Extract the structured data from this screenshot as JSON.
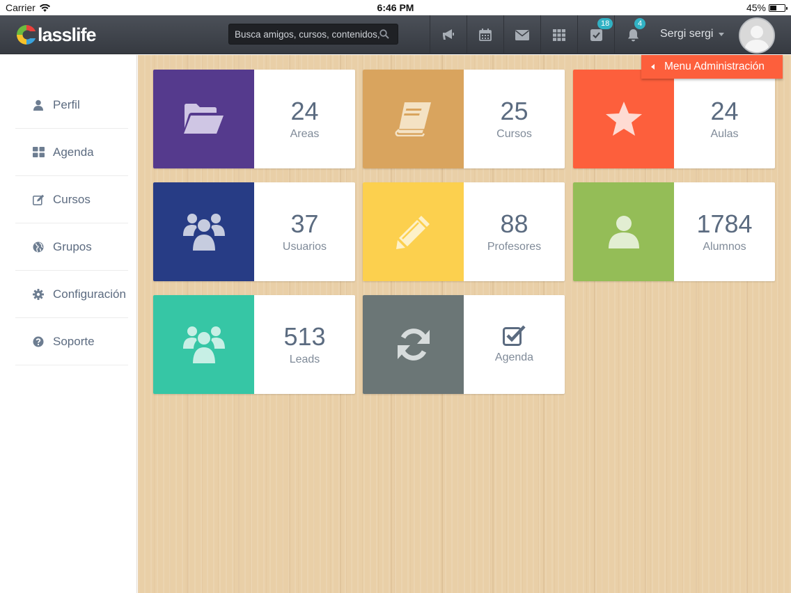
{
  "statusbar": {
    "carrier": "Carrier",
    "time": "6:46 PM",
    "battery": "45%",
    "battery_level": 0.45
  },
  "navbar": {
    "logo_text": "lasslife",
    "search_placeholder": "Busca amigos, cursos, contenidos, in",
    "icons": [
      "megaphone-icon",
      "calendar-icon",
      "envelope-icon",
      "grid-icon",
      "check-square-icon",
      "bell-icon"
    ],
    "tasks_badge": "18",
    "notifications_badge": "4",
    "user_name": "Sergi sergi"
  },
  "admin_menu": {
    "label": "Menu Administración"
  },
  "sidebar": {
    "items": [
      {
        "label": "Perfil",
        "icon": "user-icon"
      },
      {
        "label": "Agenda",
        "icon": "dashboard-icon"
      },
      {
        "label": "Cursos",
        "icon": "edit-icon"
      },
      {
        "label": "Grupos",
        "icon": "globe-icon"
      },
      {
        "label": "Configuración",
        "icon": "gear-icon"
      },
      {
        "label": "Soporte",
        "icon": "question-icon"
      }
    ]
  },
  "tiles": [
    {
      "value": "24",
      "label": "Areas",
      "icon": "folder-open-icon",
      "color": "#553a8d"
    },
    {
      "value": "25",
      "label": "Cursos",
      "icon": "book-icon",
      "color": "#d9a45e"
    },
    {
      "value": "24",
      "label": "Aulas",
      "icon": "star-icon",
      "color": "#fd5f3c"
    },
    {
      "value": "37",
      "label": "Usuarios",
      "icon": "users-icon",
      "color": "#273c85"
    },
    {
      "value": "88",
      "label": "Profesores",
      "icon": "pencil-icon",
      "color": "#fcd04e"
    },
    {
      "value": "1784",
      "label": "Alumnos",
      "icon": "user-icon",
      "color": "#94bd57"
    },
    {
      "value": "513",
      "label": "Leads",
      "icon": "users-icon",
      "color": "#36c6a5"
    },
    {
      "value": "",
      "label": "Agenda",
      "icon": "refresh-icon",
      "color": "#6b7676",
      "info_icon": "check-square-icon"
    }
  ],
  "colors": {
    "navbar": "#3f434a",
    "accent": "#fd5f3c",
    "badge": "#31b2c4",
    "text": "#5b6b80"
  }
}
